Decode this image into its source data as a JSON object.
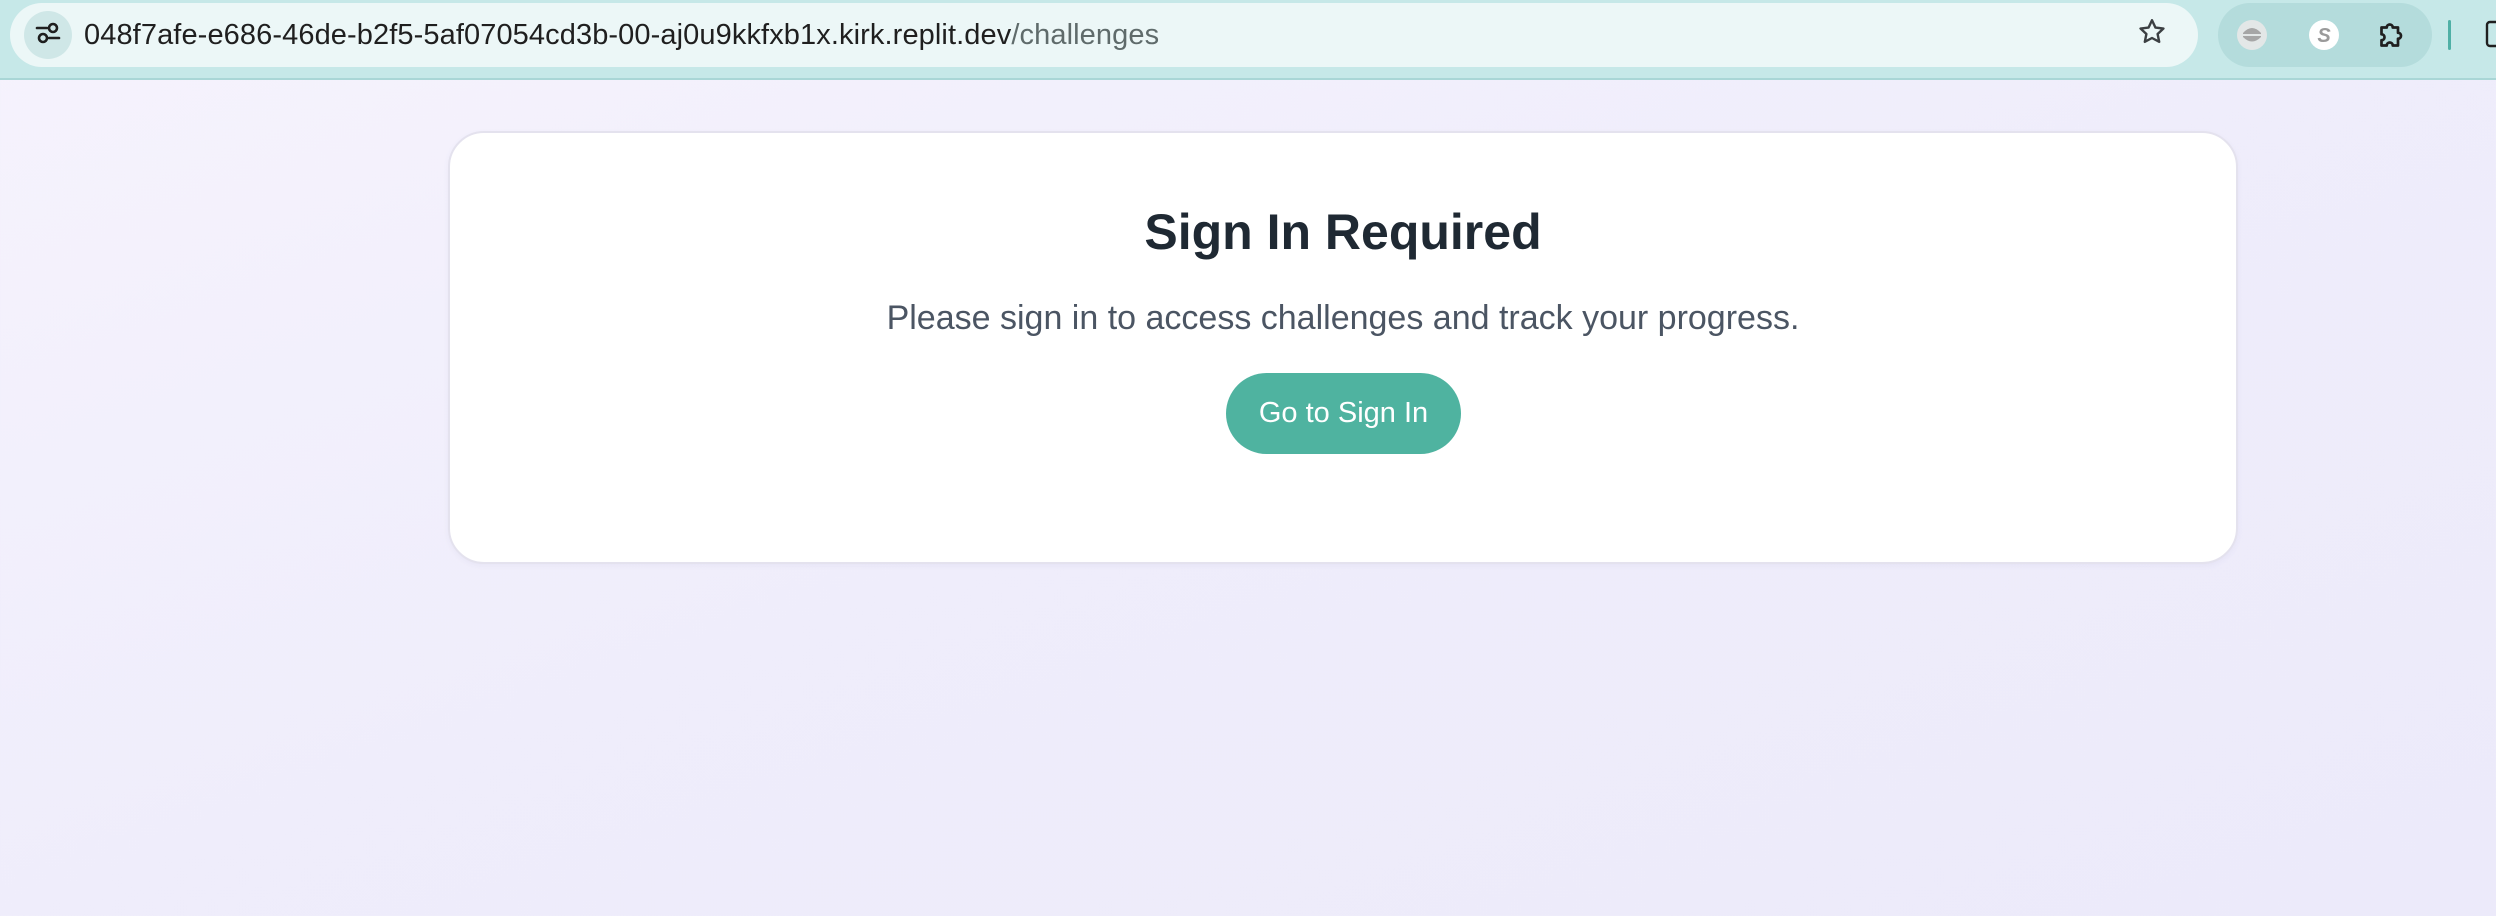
{
  "browser": {
    "url_host": "048f7afe-e686-46de-b2f5-5af07054cd3b-00-aj0u9kkfxb1x.kirk.replit.dev",
    "url_path": "/challenges",
    "icons": {
      "site_info": "tune-icon",
      "bookmark": "star-icon",
      "extensions": [
        "shield-extension-icon",
        "s-extension-icon",
        "puzzle-extension-icon"
      ],
      "side_panel": "side-panel-icon"
    },
    "colors": {
      "toolbar": "#c6e8e8",
      "omnibox": "#ecf7f7"
    }
  },
  "signin_card": {
    "title": "Sign In Required",
    "message": "Please sign in to access challenges and track your progress.",
    "button_label": "Go to Sign In"
  },
  "colors": {
    "accent": "#4fb3a0",
    "title": "#1f2933",
    "body_text": "#4b5563"
  }
}
